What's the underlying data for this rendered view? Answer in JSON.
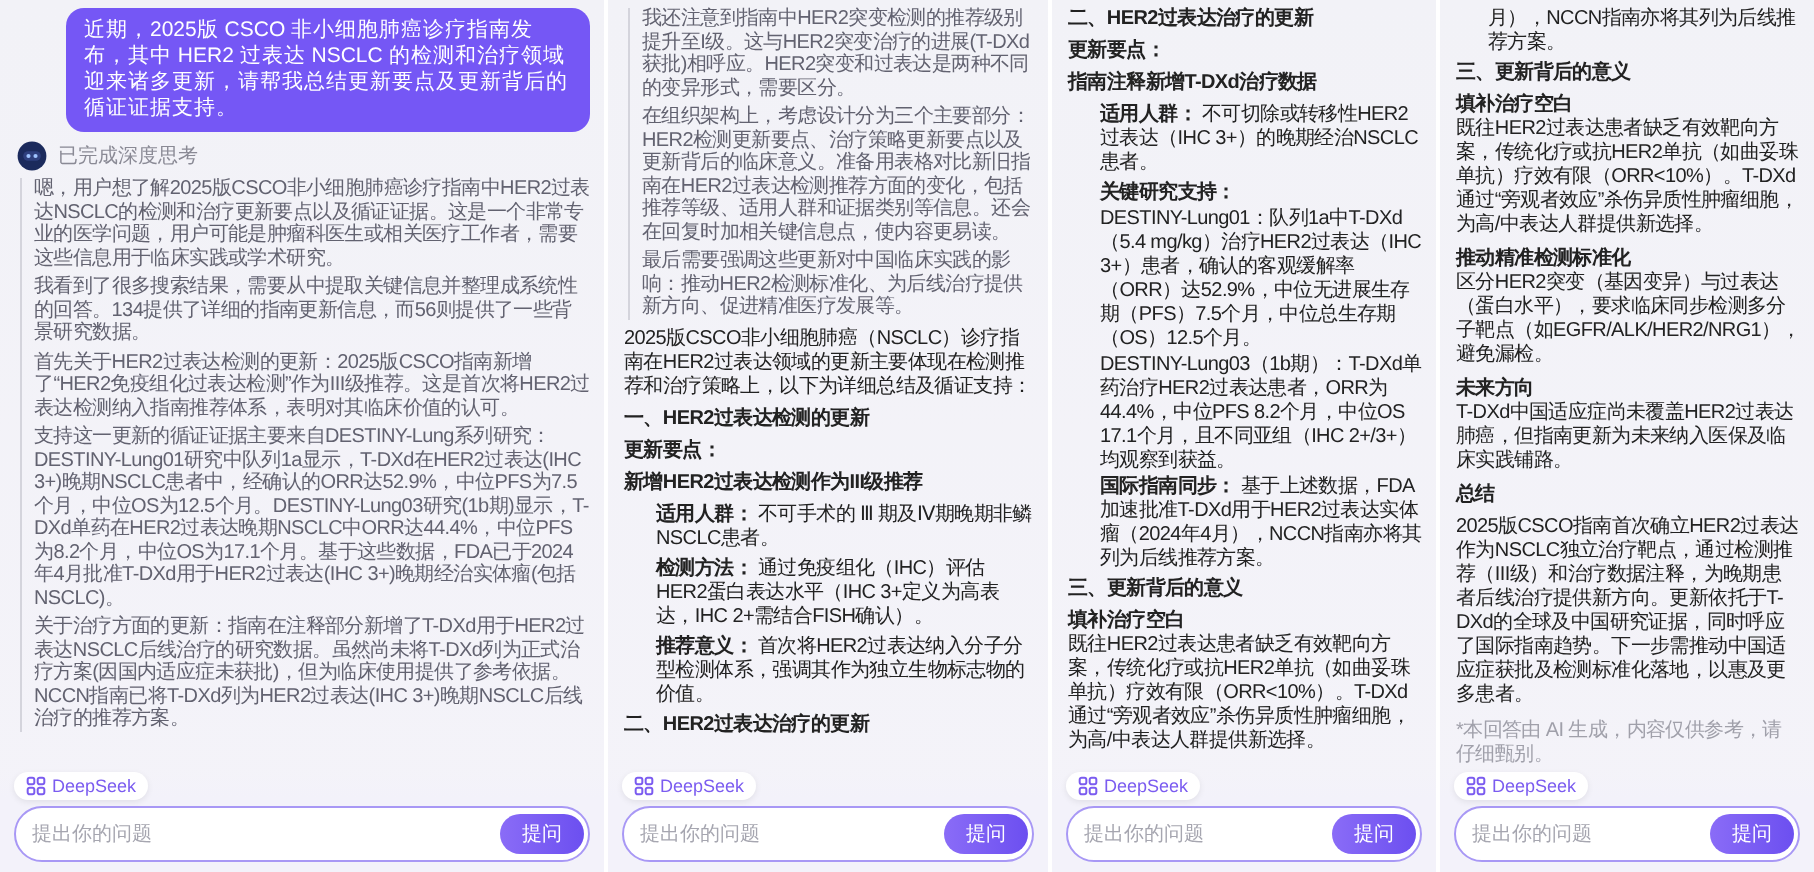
{
  "panels": [
    {
      "user_message": "近期，2025版 CSCO 非小细胞肺癌诊疗指南发布，其中 HER2 过表达 NSCLC 的检测和治疗领域迎来诸多更新，请帮我总结更新要点及更新背后的循证证据支持。",
      "thinking": {
        "label": "已完成深度思考",
        "paragraphs": [
          "嗯，用户想了解2025版CSCO非小细胞肺癌诊疗指南中HER2过表达NSCLC的检测和治疗更新要点以及循证证据。这是一个非常专业的医学问题，用户可能是肿瘤科医生或相关医疗工作者，需要这些信息用于临床实践或学术研究。",
          "我看到了很多搜索结果，需要从中提取关键信息并整理成系统性的回答。134提供了详细的指南更新信息，而56则提供了一些背景研究数据。",
          "首先关于HER2过表达检测的更新：2025版CSCO指南新增了“HER2免疫组化过表达检测”作为III级推荐。这是首次将HER2过表达检测纳入指南推荐体系，表明对其临床价值的认可。",
          "支持这一更新的循证证据主要来自DESTINY-Lung系列研究：DESTINY-Lung01研究中队列1a显示，T-DXd在HER2过表达(IHC 3+)晚期NSCLC患者中，经确认的ORR达52.9%，中位PFS为7.5个月，中位OS为12.5个月。DESTINY-Lung03研究(1b期)显示，T-DXd单药在HER2过表达晚期NSCLC中ORR达44.4%，中位PFS为8.2个月，中位OS为17.1个月。基于这些数据，FDA已于2024年4月批准T-DXd用于HER2过表达(IHC 3+)晚期经治实体瘤(包括NSCLC)。",
          "关于治疗方面的更新：指南在注释部分新增了T-DXd用于HER2过表达NSCLC后线治疗的研究数据。虽然尚未将T-DXd列为正式治疗方案(因国内适应症未获批)，但为临床使用提供了参考依据。NCCN指南已将T-DXd列为HER2过表达(IHC 3+)晚期NSCLC后线治疗的推荐方案。"
        ]
      },
      "badge": "DeepSeek",
      "input": {
        "placeholder": "提出你的问题",
        "button": "提问"
      }
    },
    {
      "thinking": {
        "paragraphs": [
          "我还注意到指南中HER2突变检测的推荐级别提升至I级。这与HER2突变治疗的进展(T-DXd获批)相呼应。HER2突变和过表达是两种不同的变异形式，需要区分。",
          "在组织架构上，考虑设计分为三个主要部分：HER2检测更新要点、治疗策略更新要点以及更新背后的临床意义。准备用表格对比新旧指南在HER2过表达检测推荐方面的变化，包括推荐等级、适用人群和证据类别等信息。还会在回复时加相关键信息点，使内容更易读。",
          "最后需要强调这些更新对中国临床实践的影响：推动HER2检测标准化、为后线治疗提供新方向、促进精准医疗发展等。"
        ]
      },
      "blocks": [
        {
          "kind": "p",
          "text": "2025版CSCO非小细胞肺癌（NSCLC）诊疗指南在HER2过表达领域的更新主要体现在检测推荐和治疗策略上，以下为详细总结及循证支持："
        },
        {
          "kind": "heading",
          "text": "一、HER2过表达检测的更新"
        },
        {
          "kind": "heading",
          "text": "更新要点："
        },
        {
          "kind": "heading",
          "text": "新增HER2过表达检测作为III级推荐"
        },
        {
          "kind": "item",
          "label": "适用人群：",
          "text": "不可手术的 Ⅲ 期及Ⅳ期晚期非鳞NSCLC患者。"
        },
        {
          "kind": "item",
          "label": "检测方法：",
          "text": "通过免疫组化（IHC）评估HER2蛋白表达水平（IHC 3+定义为高表达，IHC 2+需结合FISH确认）。"
        },
        {
          "kind": "item",
          "label": "推荐意义：",
          "text": "首次将HER2过表达纳入分子分型检测体系，强调其作为独立生物标志物的价值。"
        },
        {
          "kind": "heading",
          "text": "二、HER2过表达治疗的更新"
        }
      ],
      "badge": "DeepSeek",
      "input": {
        "placeholder": "提出你的问题",
        "button": "提问"
      }
    },
    {
      "blocks": [
        {
          "kind": "heading",
          "text": "二、HER2过表达治疗的更新"
        },
        {
          "kind": "heading",
          "text": "更新要点："
        },
        {
          "kind": "heading",
          "text": "指南注释新增T-DXd治疗数据"
        },
        {
          "kind": "item",
          "label": "适用人群：",
          "text": "不可切除或转移性HER2过表达（IHC 3+）的晚期经治NSCLC患者。"
        },
        {
          "kind": "item",
          "label": "关键研究支持：",
          "lines": [
            "DESTINY-Lung01：队列1a中T-DXd（5.4 mg/kg）治疗HER2过表达（IHC 3+）患者，确认的客观缓解率（ORR）达52.9%，中位无进展生存期（PFS）7.5个月，中位总生存期（OS）12.5个月。",
            "DESTINY-Lung03（1b期）：T-DXd单药治疗HER2过表达患者，ORR为44.4%，中位PFS 8.2个月，中位OS 17.1个月，且不同亚组（IHC 2+/3+）均观察到获益。"
          ]
        },
        {
          "kind": "item",
          "label": "国际指南同步：",
          "text": "基于上述数据，FDA加速批准T-DXd用于HER2过表达实体瘤（2024年4月），NCCN指南亦将其列为后线推荐方案。"
        },
        {
          "kind": "heading",
          "text": "三、更新背后的意义"
        },
        {
          "kind": "titled",
          "title": "填补治疗空白",
          "text": "既往HER2过表达患者缺乏有效靶向方案，传统化疗或抗HER2单抗（如曲妥珠单抗）疗效有限（ORR<10%）。T-DXd通过“旁观者效应”杀伤异质性肿瘤细胞，为高/中表达人群提供新选择。"
        }
      ],
      "badge": "DeepSeek",
      "input": {
        "placeholder": "提出你的问题",
        "button": "提问"
      }
    },
    {
      "blocks": [
        {
          "kind": "cont",
          "text": "月），NCCN指南亦将其列为后线推荐方案。"
        },
        {
          "kind": "heading",
          "text": "三、更新背后的意义"
        },
        {
          "kind": "titled",
          "title": "填补治疗空白",
          "text": "既往HER2过表达患者缺乏有效靶向方案，传统化疗或抗HER2单抗（如曲妥珠单抗）疗效有限（ORR<10%）。T-DXd通过“旁观者效应”杀伤异质性肿瘤细胞，为高/中表达人群提供新选择。"
        },
        {
          "kind": "titled",
          "title": "推动精准检测标准化",
          "text": "区分HER2突变（基因变异）与过表达（蛋白水平），要求临床同步检测多分子靶点（如EGFR/ALK/HER2/NRG1），避免漏检。"
        },
        {
          "kind": "titled",
          "title": "未来方向",
          "text": "T-DXd中国适应症尚未覆盖HER2过表达肺癌，但指南更新为未来纳入医保及临床实践铺路。"
        },
        {
          "kind": "heading",
          "text": "总结"
        },
        {
          "kind": "p",
          "text": "2025版CSCO指南首次确立HER2过表达作为NSCLC独立治疗靶点，通过检测推荐（III级）和治疗数据注释，为晚期患者后线治疗提供新方向。更新依托于T-DXd的全球及中国研究证据，同时呼应了国际指南趋势。下一步需推动中国适应症获批及检测标准化落地，以惠及更多患者。"
        },
        {
          "kind": "note",
          "text": "*本回答由 AI 生成，内容仅供参考，请仔细甄别。"
        }
      ],
      "badge": "DeepSeek",
      "input": {
        "placeholder": "提出你的问题",
        "button": "提问"
      }
    }
  ]
}
